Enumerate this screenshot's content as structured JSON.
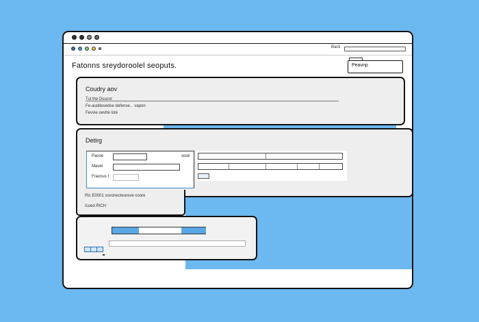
{
  "window": {
    "toolbar_label": "Back"
  },
  "header": {
    "title": "Fatonns sreydoroolel seoputs.",
    "button_label": "Peavnp"
  },
  "card1": {
    "heading": "Coudry aov",
    "line1": "Tul the Doucor",
    "line2": "Fe-auddesedse defense. . vapon",
    "line3": "Fevvie oevtte lote"
  },
  "card2": {
    "heading": "Detirg",
    "labels": [
      "Pacoe",
      "Mavel",
      "Fracnus I"
    ],
    "mid_label": "sosk"
  },
  "below_card2": {
    "line1": "Ric E0001 sovonecteoreve coore",
    "line2": "Icoed RICH"
  }
}
